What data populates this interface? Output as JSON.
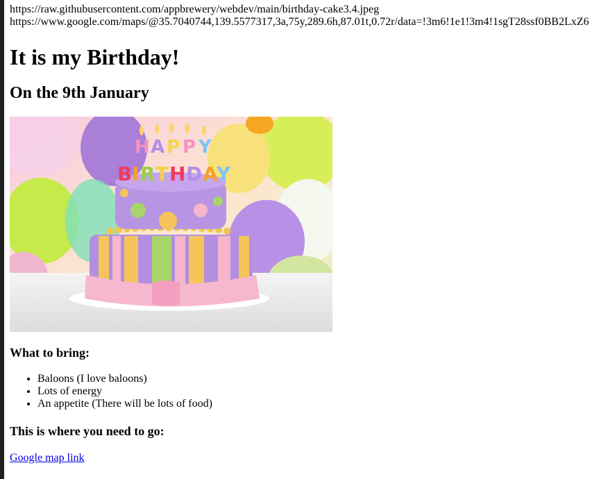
{
  "urls": {
    "image_url": "https://raw.githubusercontent.com/appbrewery/webdev/main/birthday-cake3.4.jpeg",
    "map_url": "https://www.google.com/maps/@35.7040744,139.5577317,3a,75y,289.6h,87.01t,0.72r/data=!3m6!1e1!3m4!1sgT28ssf0BB2LxZ6"
  },
  "heading": "It is my Birthday!",
  "subheading": "On the 9th January",
  "photo": {
    "icon": "birthday-cake-image",
    "candle_text_top": "HAPPY",
    "candle_text_bottom": "BIRTHDAY"
  },
  "bring": {
    "title": "What to bring:",
    "items": [
      "Baloons (I love baloons)",
      "Lots of energy",
      "An appetite (There will be lots of food)"
    ]
  },
  "where": {
    "title": "This is where you need to go:"
  },
  "map_link": {
    "label": "Google map link"
  },
  "colors": {
    "link": "#0000ee",
    "left_bar": "#1f1f1f"
  }
}
